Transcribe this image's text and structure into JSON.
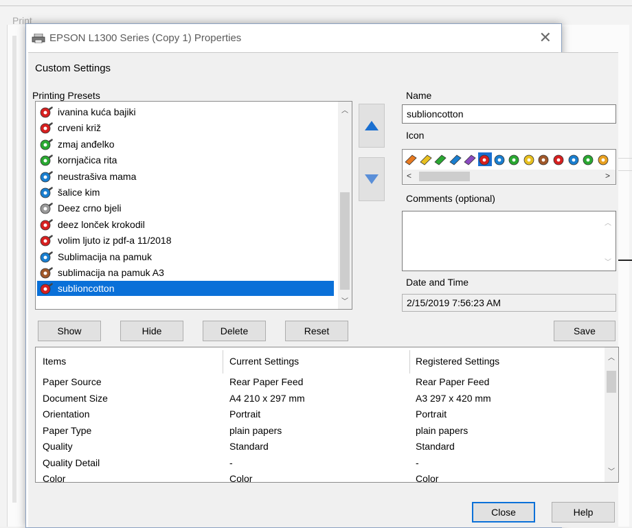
{
  "background_window": {
    "title": "Print"
  },
  "dialog": {
    "title": "EPSON L1300 Series (Copy 1) Properties",
    "section_title": "Custom Settings"
  },
  "presets": {
    "label": "Printing Presets",
    "items": [
      {
        "label": "ivanina kuća bajiki",
        "color": "#d62020"
      },
      {
        "label": "crveni križ",
        "color": "#d62020"
      },
      {
        "label": "zmaj anđelko",
        "color": "#2aa832"
      },
      {
        "label": "kornjačica rita",
        "color": "#2aa832"
      },
      {
        "label": "neustrašiva mama",
        "color": "#1a7ecf"
      },
      {
        "label": "šalice kim",
        "color": "#1a7ecf"
      },
      {
        "label": "Deez crno bjeli",
        "color": "#9a9a9a"
      },
      {
        "label": "deez lonček krokodil",
        "color": "#d62020"
      },
      {
        "label": "volim ljuto iz pdf-a 11/2018",
        "color": "#d62020"
      },
      {
        "label": "Sublimacija na pamuk",
        "color": "#1a7ecf"
      },
      {
        "label": "sublimacija na pamuk A3",
        "color": "#a0582a"
      },
      {
        "label": "sublioncotton",
        "color": "#d62020",
        "selected": true
      }
    ]
  },
  "name": {
    "label": "Name",
    "value": "sublioncotton"
  },
  "icon": {
    "label": "Icon"
  },
  "comments": {
    "label": "Comments (optional)",
    "value": ""
  },
  "datetime": {
    "label": "Date and Time",
    "value": "2/15/2019 7:56:23 AM"
  },
  "buttons": {
    "show": "Show",
    "hide": "Hide",
    "delete": "Delete",
    "reset": "Reset",
    "save": "Save",
    "close": "Close",
    "help": "Help"
  },
  "table": {
    "headers": [
      "Items",
      "Current Settings",
      "Registered Settings"
    ],
    "rows": [
      [
        "Paper Source",
        "Rear Paper Feed",
        "Rear Paper Feed"
      ],
      [
        "Document Size",
        "A4 210 x 297 mm",
        "A3 297 x 420 mm"
      ],
      [
        "Orientation",
        "Portrait",
        "Portrait"
      ],
      [
        "Paper Type",
        "plain papers",
        "plain papers"
      ],
      [
        "Quality",
        "Standard",
        "Standard"
      ],
      [
        "Quality Detail",
        "-",
        "-"
      ],
      [
        "Color",
        "Color",
        "Color"
      ]
    ]
  },
  "colors": {
    "accent": "#0a70d8",
    "arrow_active": "#1a6fd0",
    "arrow_inactive": "#5a8fd8"
  },
  "icon_strip": [
    "#e87a20",
    "#e8c020",
    "#2aa832",
    "#1a7ecf",
    "#8a4ac0",
    "#d62020",
    "#1a7ecf",
    "#2aa832",
    "#e8c020",
    "#a0582a",
    "#d62020",
    "#1a7ecf",
    "#2aa832",
    "#e8a020"
  ]
}
